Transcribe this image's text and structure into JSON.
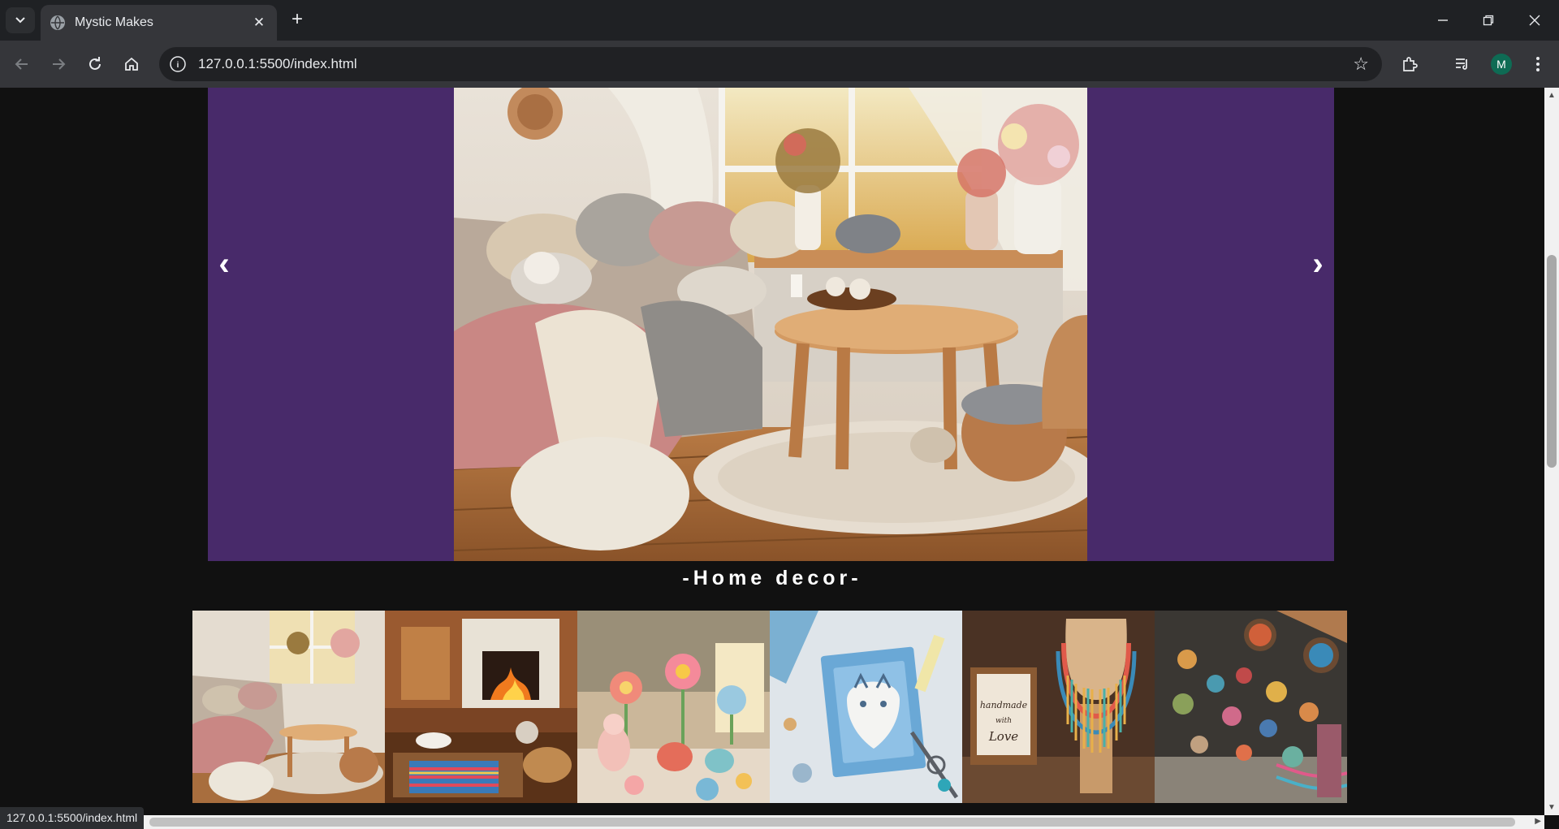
{
  "browser": {
    "tab_title": "Mystic Makes",
    "url": "127.0.0.1:5500/index.html",
    "status_url": "127.0.0.1:5500/index.html",
    "profile_initial": "M"
  },
  "icons": {
    "back": "back-arrow-icon",
    "forward": "forward-arrow-icon",
    "reload": "reload-icon",
    "home": "home-icon",
    "info": "site-info-icon",
    "bookmark": "star-icon",
    "extensions": "puzzle-icon",
    "media": "media-control-icon",
    "menu": "kebab-menu-icon"
  },
  "slider": {
    "prev_label": "‹",
    "next_label": "›",
    "caption": "-Home decor-",
    "background_color": "#482a6a"
  },
  "thumbnails": [
    {
      "subject": "cozy knitted living room"
    },
    {
      "subject": "fireplace with knitting"
    },
    {
      "subject": "felt flowers and animals"
    },
    {
      "subject": "handmade cat card"
    },
    {
      "subject": "handmade with love beaded necklace"
    },
    {
      "subject": "buttons and beads"
    }
  ]
}
